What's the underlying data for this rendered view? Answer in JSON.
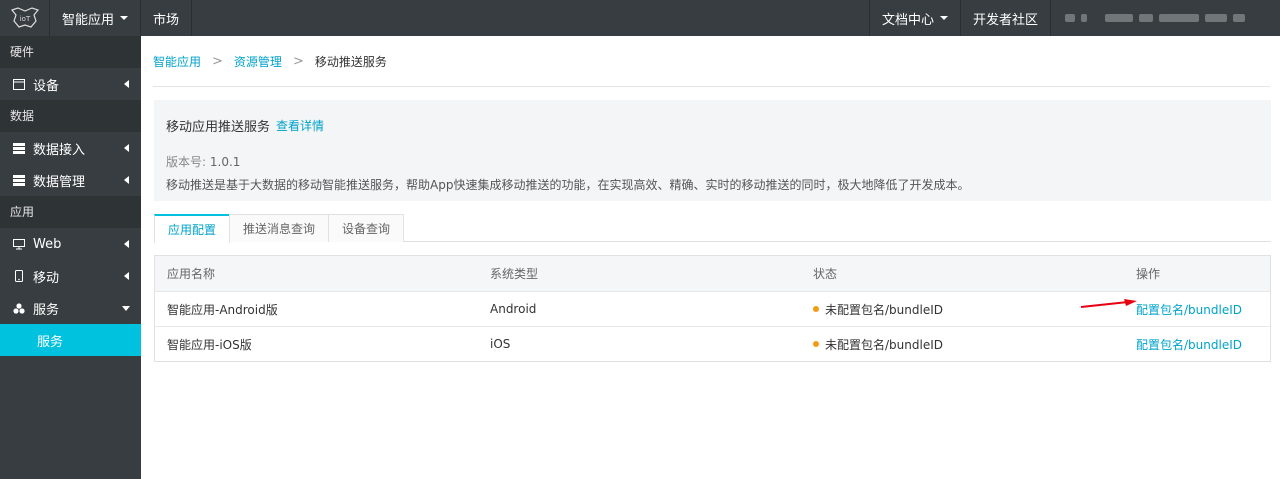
{
  "topbar": {
    "app_menu": "智能应用",
    "market": "市场",
    "docs": "文档中心",
    "dev_community": "开发者社区"
  },
  "sidebar": {
    "group_hardware": "硬件",
    "device": "设备",
    "group_data": "数据",
    "data_access": "数据接入",
    "data_manage": "数据管理",
    "group_app": "应用",
    "web": "Web",
    "mobile": "移动",
    "service": "服务",
    "service_sub": "服务"
  },
  "breadcrumb": {
    "item1": "智能应用",
    "item2": "资源管理",
    "current": "移动推送服务",
    "separator": ">"
  },
  "info": {
    "title": "移动应用推送服务",
    "detail_link": "查看详情",
    "version_label": "版本号:",
    "version": "1.0.1",
    "description": "移动推送是基于大数据的移动智能推送服务，帮助App快速集成移动推送的功能，在实现高效、精确、实时的移动推送的同时，极大地降低了开发成本。"
  },
  "tabs": [
    "应用配置",
    "推送消息查询",
    "设备查询"
  ],
  "table": {
    "headers": [
      "应用名称",
      "系统类型",
      "状态",
      "操作"
    ],
    "rows": [
      {
        "name": "智能应用-Android版",
        "os": "Android",
        "status": "未配置包名/bundleID",
        "action": "配置包名/bundleID"
      },
      {
        "name": "智能应用-iOS版",
        "os": "iOS",
        "status": "未配置包名/bundleID",
        "action": "配置包名/bundleID"
      }
    ]
  },
  "colors": {
    "topbar_bg": "#373d41",
    "accent": "#00c1de",
    "link": "#00a2ca",
    "status_dot": "#f39c12",
    "annotation_arrow": "#e60012"
  }
}
